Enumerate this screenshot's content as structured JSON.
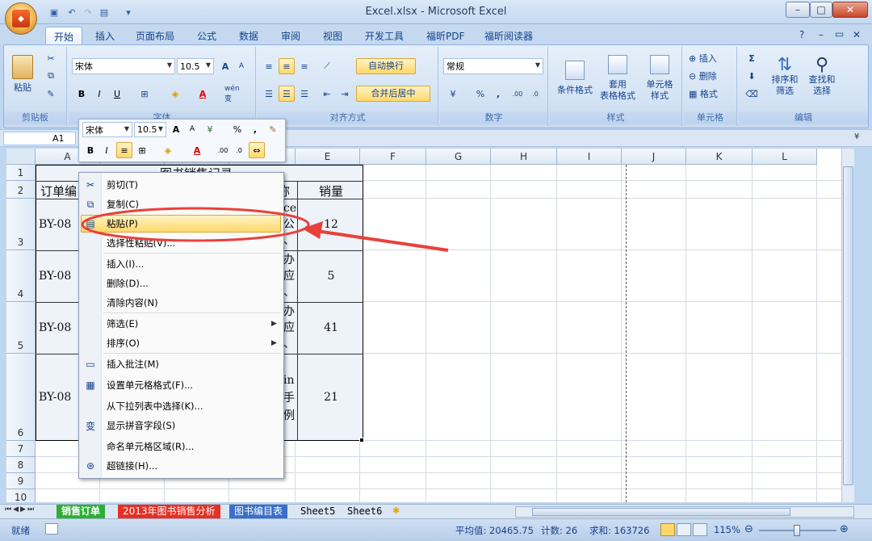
{
  "window": {
    "title": "Excel.xlsx - Microsoft Excel",
    "office_button": "Office",
    "minimize": "–",
    "maximize": "□",
    "close": "✕"
  },
  "quick_access": [
    "save-icon",
    "undo-icon",
    "redo-icon",
    "print-preview-icon",
    "customize-icon"
  ],
  "ribbon_tabs": [
    "开始",
    "插入",
    "页面布局",
    "公式",
    "数据",
    "审阅",
    "视图",
    "开发工具",
    "福昕PDF",
    "福昕阅读器"
  ],
  "active_tab": "开始",
  "ribbon_right": {
    "help": "?",
    "min": "–",
    "restore": "▭",
    "close": "✕"
  },
  "ribbon": {
    "clipboard": {
      "label": "剪贴板",
      "paste": "粘贴"
    },
    "font": {
      "label": "字体",
      "name": "宋体",
      "size": "10.5",
      "bold": "B",
      "italic": "I",
      "underline": "U",
      "phonetic": "wén 变",
      "grow": "A",
      "shrink": "A"
    },
    "alignment": {
      "label": "对齐方式",
      "wrap": "自动换行",
      "merge": "合并后居中"
    },
    "number": {
      "label": "数字",
      "format": "常规",
      "percent": "%",
      "comma": ","
    },
    "styles": {
      "label": "样式",
      "conditional": "条件格式",
      "table": "套用\n表格格式",
      "cell": "单元格\n样式"
    },
    "cells": {
      "label": "单元格",
      "insert": "插入",
      "delete": "删除",
      "format": "格式"
    },
    "editing": {
      "label": "编辑",
      "sort": "排序和\n筛选",
      "find": "查找和\n选择",
      "sigma": "Σ"
    }
  },
  "name_box": "A1",
  "mini_toolbar": {
    "font": "宋体",
    "size": "10.5",
    "bold": "B",
    "italic": "I",
    "percent": "%",
    "comma": ","
  },
  "columns": [
    "A",
    "B",
    "C",
    "D",
    "E",
    "F",
    "G",
    "H",
    "I",
    "J",
    "K",
    "L"
  ],
  "rows": [
    "1",
    "2",
    "3",
    "4",
    "5",
    "6",
    "7",
    "8",
    "9",
    "10"
  ],
  "cells": {
    "title": "图书销售记录",
    "header_a": "订单编",
    "header_d": "称",
    "header_e": "销量",
    "a3": "BY-08",
    "a4": "BY-08",
    "a5": "BY-08",
    "a6": "BY-08",
    "d3": [
      "ce",
      "公",
      "、"
    ],
    "d4": [
      "办",
      "应",
      "、"
    ],
    "d5": [
      "办",
      "应",
      "、"
    ],
    "d6": [
      "in",
      "手",
      "例"
    ],
    "e3": "12",
    "e4": "5",
    "e5": "41",
    "e6": "21"
  },
  "context_menu": [
    {
      "label": "剪切(T)",
      "icon": "scissors-icon"
    },
    {
      "label": "复制(C)",
      "icon": "copy-icon"
    },
    {
      "label": "粘贴(P)",
      "icon": "paste-icon",
      "highlighted": true
    },
    {
      "label": "选择性粘贴(V)...",
      "icon": ""
    },
    {
      "label": "插入(I)...",
      "icon": ""
    },
    {
      "label": "删除(D)...",
      "icon": ""
    },
    {
      "label": "清除内容(N)",
      "icon": ""
    },
    {
      "label": "筛选(E)",
      "icon": "",
      "submenu": true
    },
    {
      "label": "排序(O)",
      "icon": "",
      "submenu": true
    },
    {
      "label": "插入批注(M)",
      "icon": "comment-icon"
    },
    {
      "label": "设置单元格格式(F)...",
      "icon": "format-cells-icon"
    },
    {
      "label": "从下拉列表中选择(K)...",
      "icon": ""
    },
    {
      "label": "显示拼音字段(S)",
      "icon": "phonetic-icon"
    },
    {
      "label": "命名单元格区域(R)...",
      "icon": ""
    },
    {
      "label": "超链接(H)...",
      "icon": "hyperlink-icon"
    }
  ],
  "sheet_tabs": [
    "销售订单",
    "2013年图书销售分析",
    "图书编目表",
    "Sheet5",
    "Sheet6"
  ],
  "active_sheet": "销售订单",
  "status": {
    "ready": "就绪",
    "average": "平均值: 20465.75",
    "count": "计数: 26",
    "sum": "求和: 163726",
    "zoom": "115%"
  },
  "colors": {
    "highlight": "#ffd86a",
    "annotation": "#e8413a",
    "selection_range": "#e9eef7"
  }
}
